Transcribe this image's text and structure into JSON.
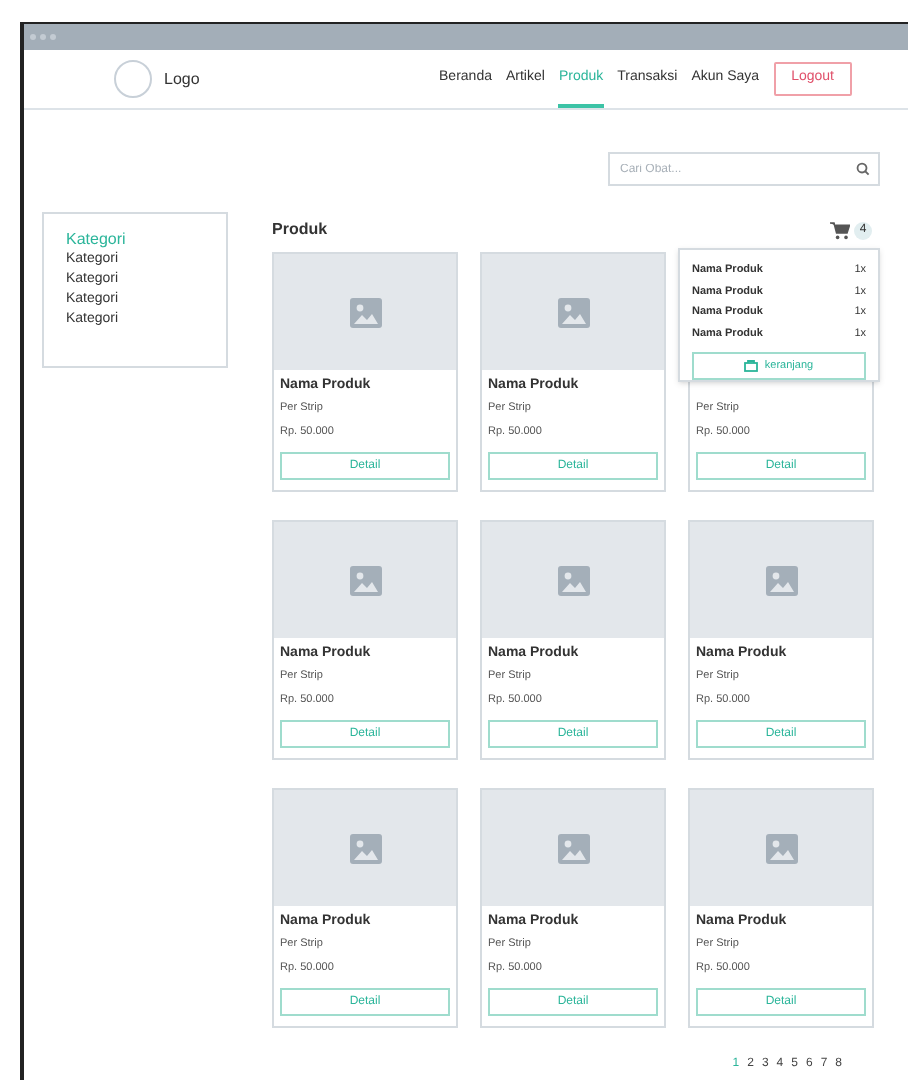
{
  "header": {
    "logo": "Logo",
    "nav": [
      {
        "label": "Beranda",
        "selected": false
      },
      {
        "label": "Artikel",
        "selected": false
      },
      {
        "label": "Produk",
        "selected": true
      },
      {
        "label": "Transaksi",
        "selected": false
      },
      {
        "label": "Akun Saya",
        "selected": false
      }
    ],
    "logout": "Logout"
  },
  "search": {
    "placeholder": "Cari Obat..."
  },
  "sidebar": {
    "categories": [
      {
        "label": "Kategori",
        "selected": true
      },
      {
        "label": "Kategori",
        "selected": false
      },
      {
        "label": "Kategori",
        "selected": false
      },
      {
        "label": "Kategori",
        "selected": false
      },
      {
        "label": "Kategori",
        "selected": false
      }
    ]
  },
  "section_title": "Produk",
  "cart": {
    "count": "4",
    "items": [
      {
        "name": "Nama Produk",
        "qty": "1x"
      },
      {
        "name": "Nama Produk",
        "qty": "1x"
      },
      {
        "name": "Nama Produk",
        "qty": "1x"
      },
      {
        "name": "Nama Produk",
        "qty": "1x"
      }
    ],
    "button": "keranjang"
  },
  "products": [
    {
      "name": "Nama Produk",
      "unit": "Per Strip",
      "price": "Rp. 50.000",
      "button": "Detail"
    },
    {
      "name": "Nama Produk",
      "unit": "Per Strip",
      "price": "Rp. 50.000",
      "button": "Detail"
    },
    {
      "unit": "Per Strip",
      "price": "Rp. 50.000",
      "button": "Detail"
    },
    {
      "name": "Nama Produk",
      "unit": "Per Strip",
      "price": "Rp. 50.000",
      "button": "Detail"
    },
    {
      "name": "Nama Produk",
      "unit": "Per Strip",
      "price": "Rp. 50.000",
      "button": "Detail"
    },
    {
      "name": "Nama Produk",
      "unit": "Per Strip",
      "price": "Rp. 50.000",
      "button": "Detail"
    },
    {
      "name": "Nama Produk",
      "unit": "Per Strip",
      "price": "Rp. 50.000",
      "button": "Detail"
    },
    {
      "name": "Nama Produk",
      "unit": "Per Strip",
      "price": "Rp. 50.000",
      "button": "Detail"
    },
    {
      "name": "Nama Produk",
      "unit": "Per Strip",
      "price": "Rp. 50.000",
      "button": "Detail"
    }
  ],
  "pagination": [
    {
      "label": "1",
      "selected": true
    },
    {
      "label": "2",
      "selected": false
    },
    {
      "label": "3",
      "selected": false
    },
    {
      "label": "4",
      "selected": false
    },
    {
      "label": "5",
      "selected": false
    },
    {
      "label": "6",
      "selected": false
    },
    {
      "label": "7",
      "selected": false
    },
    {
      "label": "8",
      "selected": false
    }
  ]
}
